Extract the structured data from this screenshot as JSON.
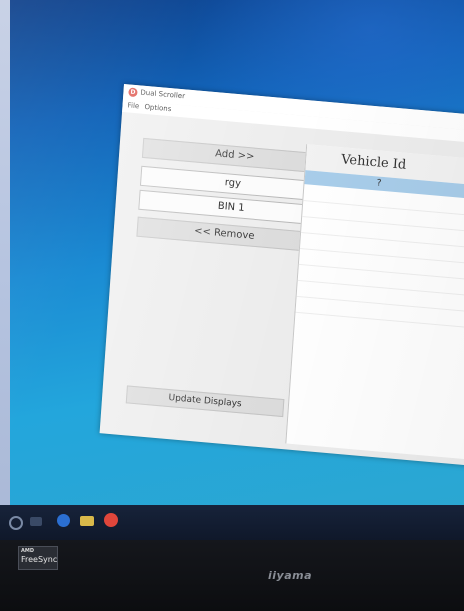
{
  "window": {
    "title": "Dual Scroller",
    "icon_letter": "D"
  },
  "menu": {
    "items": [
      "File",
      "Options"
    ]
  },
  "controls": {
    "add_label": "Add >>",
    "fields": [
      "rgy",
      "BIN 1"
    ],
    "remove_label": "<< Remove",
    "update_label": "Update Displays"
  },
  "list": {
    "header": "Vehicle Id",
    "rows": [
      "?"
    ],
    "selected_color": "#a8cdea"
  },
  "monitor": {
    "badge_brand": "AMD",
    "badge_label": "FreeSync",
    "brand": "iiyama"
  },
  "icons": {
    "app": "app-d-icon",
    "taskbar": [
      "windows-start-icon",
      "task-view-icon",
      "edge-icon",
      "file-explorer-icon",
      "dual-scroller-taskbar-icon"
    ]
  }
}
